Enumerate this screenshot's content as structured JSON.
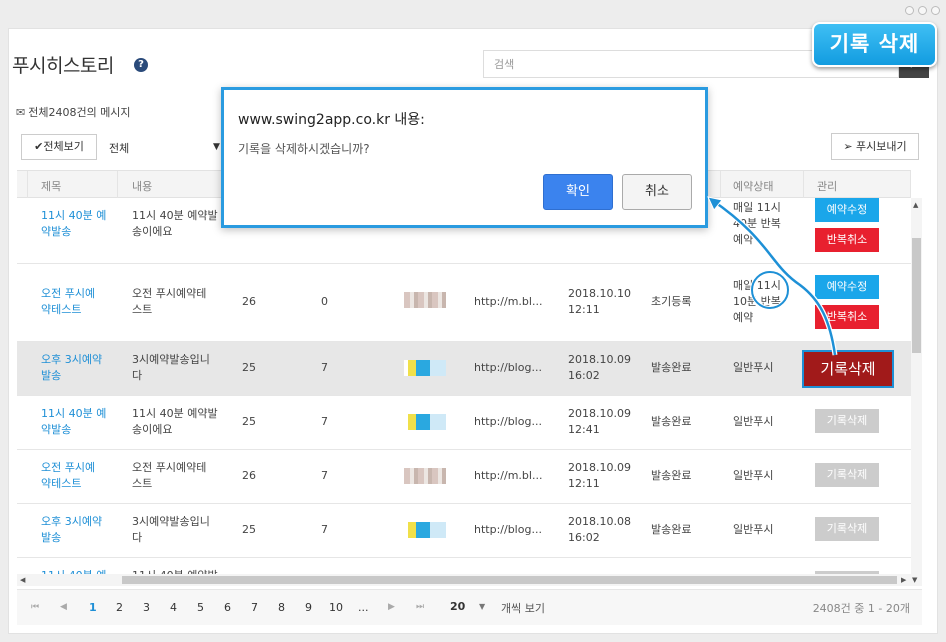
{
  "page": {
    "title": "푸시히스토리",
    "help": "?"
  },
  "search": {
    "placeholder": "검색",
    "icon": "search-icon"
  },
  "callout": {
    "label": "기록 삭제"
  },
  "summary": {
    "text": "전체2408건의 메시지"
  },
  "toolbar": {
    "view_all": "✔전체보기",
    "filter_value": "전체",
    "send_push": "푸시보내기"
  },
  "table": {
    "headers": [
      "제목",
      "내용",
      "예약상태",
      "관리"
    ],
    "rows": [
      {
        "title": [
          "11시 40분 예",
          "약발송"
        ],
        "content": [
          "11시 40분 예약발",
          "송이에요"
        ],
        "reserve": [
          "매일 11시",
          "40분 반복",
          "예약"
        ],
        "buttons": [
          "예약수정",
          "반복취소"
        ]
      },
      {
        "title": [
          "오전 푸시예",
          "약테스트"
        ],
        "content": [
          "오전 푸시예약테",
          "스트"
        ],
        "c1": "26",
        "c2": "0",
        "thumb": "photo",
        "url": "http://m.bl...",
        "date": [
          "2018.10.10",
          "12:11"
        ],
        "status": "초기등록",
        "reserve": [
          "매일 11시",
          "10분 반복",
          "예약"
        ],
        "buttons": [
          "예약수정",
          "반복취소"
        ]
      },
      {
        "title": [
          "오후 3시예약",
          "발송"
        ],
        "content": [
          "3시예약발송입니",
          "다"
        ],
        "c1": "25",
        "c2": "7",
        "thumb": "blue",
        "url": "http://blog...",
        "date": [
          "2018.10.09",
          "16:02"
        ],
        "status": "발송완료",
        "reserve": [
          "일반푸시"
        ],
        "delete": "기록삭제"
      },
      {
        "title": [
          "11시 40분 예",
          "약발송"
        ],
        "content": [
          "11시 40분 예약발",
          "송이에요"
        ],
        "c1": "25",
        "c2": "7",
        "thumb": "blue",
        "url": "http://blog...",
        "date": [
          "2018.10.09",
          "12:41"
        ],
        "status": "발송완료",
        "reserve": [
          "일반푸시"
        ],
        "delete": "기록삭제"
      },
      {
        "title": [
          "오전 푸시예",
          "약테스트"
        ],
        "content": [
          "오전 푸시예약테",
          "스트"
        ],
        "c1": "26",
        "c2": "7",
        "thumb": "photo",
        "url": "http://m.bl...",
        "date": [
          "2018.10.09",
          "12:11"
        ],
        "status": "발송완료",
        "reserve": [
          "일반푸시"
        ],
        "delete": "기록삭제"
      },
      {
        "title": [
          "오후 3시예약",
          "발송"
        ],
        "content": [
          "3시예약발송입니",
          "다"
        ],
        "c1": "25",
        "c2": "7",
        "thumb": "blue",
        "url": "http://blog...",
        "date": [
          "2018.10.08",
          "16:02"
        ],
        "status": "발송완료",
        "reserve": [
          "일반푸시"
        ],
        "delete": "기록삭제"
      }
    ]
  },
  "pagination": {
    "pages": [
      "1",
      "2",
      "3",
      "4",
      "5",
      "6",
      "7",
      "8",
      "9",
      "10",
      "..."
    ],
    "per_page": "20",
    "per_page_label": "개씩 보기",
    "info": "2408건 중 1 - 20개"
  },
  "dialog": {
    "title": "www.swing2app.co.kr 내용:",
    "message": "기록을 삭제하시겠습니까?",
    "ok": "확인",
    "cancel": "취소"
  },
  "colors": {
    "accent": "#1e8fd6",
    "danger": "#e8202f",
    "highlight_delete": "#a11a1a",
    "dialog_border": "#2a9be0"
  }
}
